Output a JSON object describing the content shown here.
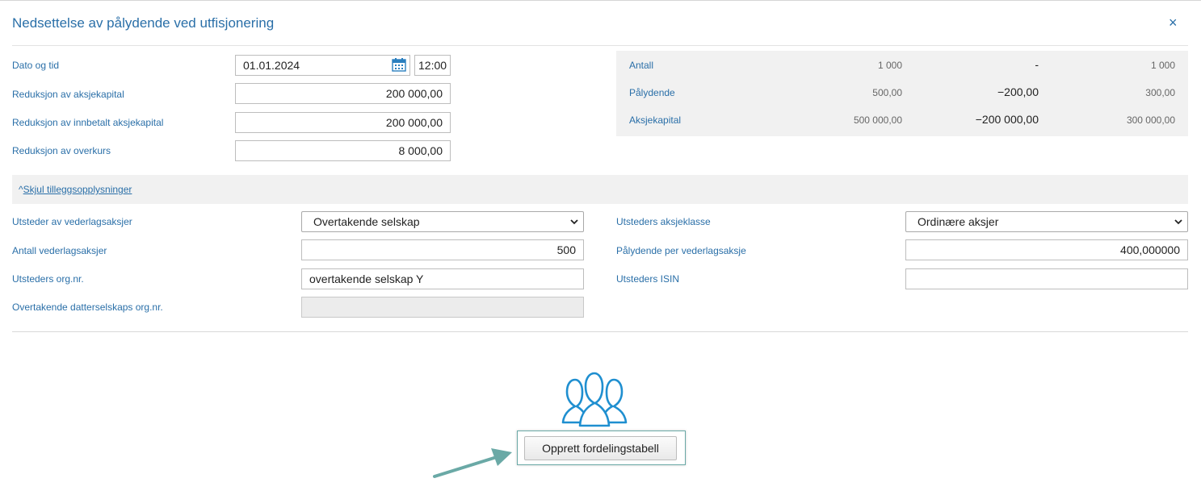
{
  "dialog": {
    "title": "Nedsettelse av pålydende ved utfisjonering",
    "close_glyph": "×"
  },
  "form": {
    "date_label": "Dato og tid",
    "date_value": "01.01.2024",
    "time_value": "12:00",
    "reduction_capital_label": "Reduksjon av aksjekapital",
    "reduction_capital_value": "200 000,00",
    "reduction_paid_label": "Reduksjon av innbetalt aksjekapital",
    "reduction_paid_value": "200 000,00",
    "reduction_premium_label": "Reduksjon av overkurs",
    "reduction_premium_value": "8 000,00"
  },
  "summary": {
    "rows": [
      {
        "label": "Antall",
        "before": "1 000",
        "change": "-",
        "after": "1 000"
      },
      {
        "label": "Pålydende",
        "before": "500,00",
        "change": "−200,00",
        "after": "300,00"
      },
      {
        "label": "Aksjekapital",
        "before": "500 000,00",
        "change": "−200 000,00",
        "after": "300 000,00"
      }
    ]
  },
  "toggle": {
    "caret": "^",
    "label": "Skjul tilleggsopplysninger"
  },
  "extra": {
    "issuer_label": "Utsteder av vederlagsaksjer",
    "issuer_value": "Overtakende selskap",
    "count_label": "Antall vederlagsaksjer",
    "count_value": "500",
    "issuer_org_label": "Utsteders org.nr.",
    "issuer_org_value": "overtakende selskap Y",
    "subsidiary_org_label": "Overtakende datterselskaps org.nr.",
    "subsidiary_org_value": "",
    "share_class_label": "Utsteders aksjeklasse",
    "share_class_value": "Ordinære aksjer",
    "nominal_label": "Pålydende per vederlagsaksje",
    "nominal_value": "400,000000",
    "isin_label": "Utsteders ISIN",
    "isin_value": ""
  },
  "actions": {
    "create_table_label": "Opprett fordelingstabell"
  },
  "icons": {
    "calendar": "calendar-icon",
    "people": "people-group-icon",
    "close": "close-icon",
    "dropdown": "chevron-down-icon"
  },
  "colors": {
    "accent": "#2a6fa8",
    "people_icon": "#1f8fd0",
    "highlight_frame": "#6aa9a6",
    "arrow": "#6aa9a6"
  }
}
